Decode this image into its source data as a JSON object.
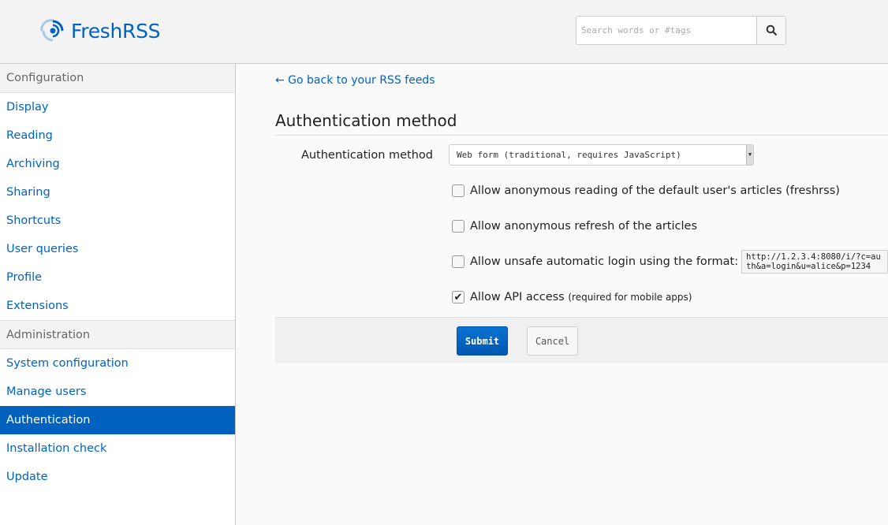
{
  "header": {
    "logo_text": "FreshRSS",
    "search_placeholder": "Search words or #tags"
  },
  "sidebar": {
    "sections": [
      {
        "title": "Configuration",
        "items": [
          "Display",
          "Reading",
          "Archiving",
          "Sharing",
          "Shortcuts",
          "User queries",
          "Profile",
          "Extensions"
        ]
      },
      {
        "title": "Administration",
        "items": [
          "System configuration",
          "Manage users",
          "Authentication",
          "Installation check",
          "Update"
        ]
      }
    ],
    "active": "Authentication"
  },
  "main": {
    "back_link": "← Go back to your RSS feeds",
    "title": "Authentication method",
    "method_label": "Authentication method",
    "method_value": "Web form (traditional, requires JavaScript)",
    "options": [
      {
        "label": "Allow anonymous reading of the default user's articles (freshrss)",
        "checked": false
      },
      {
        "label": "Allow anonymous refresh of the articles",
        "checked": false
      },
      {
        "label": "Allow unsafe automatic login using the format:",
        "checked": false,
        "code": "http://1.2.3.4:8080/i/?c=auth&a=login&u=alice&p=1234"
      },
      {
        "label": "Allow API access",
        "note": "(required for mobile apps)",
        "checked": true
      }
    ],
    "submit": "Submit",
    "cancel": "Cancel"
  }
}
